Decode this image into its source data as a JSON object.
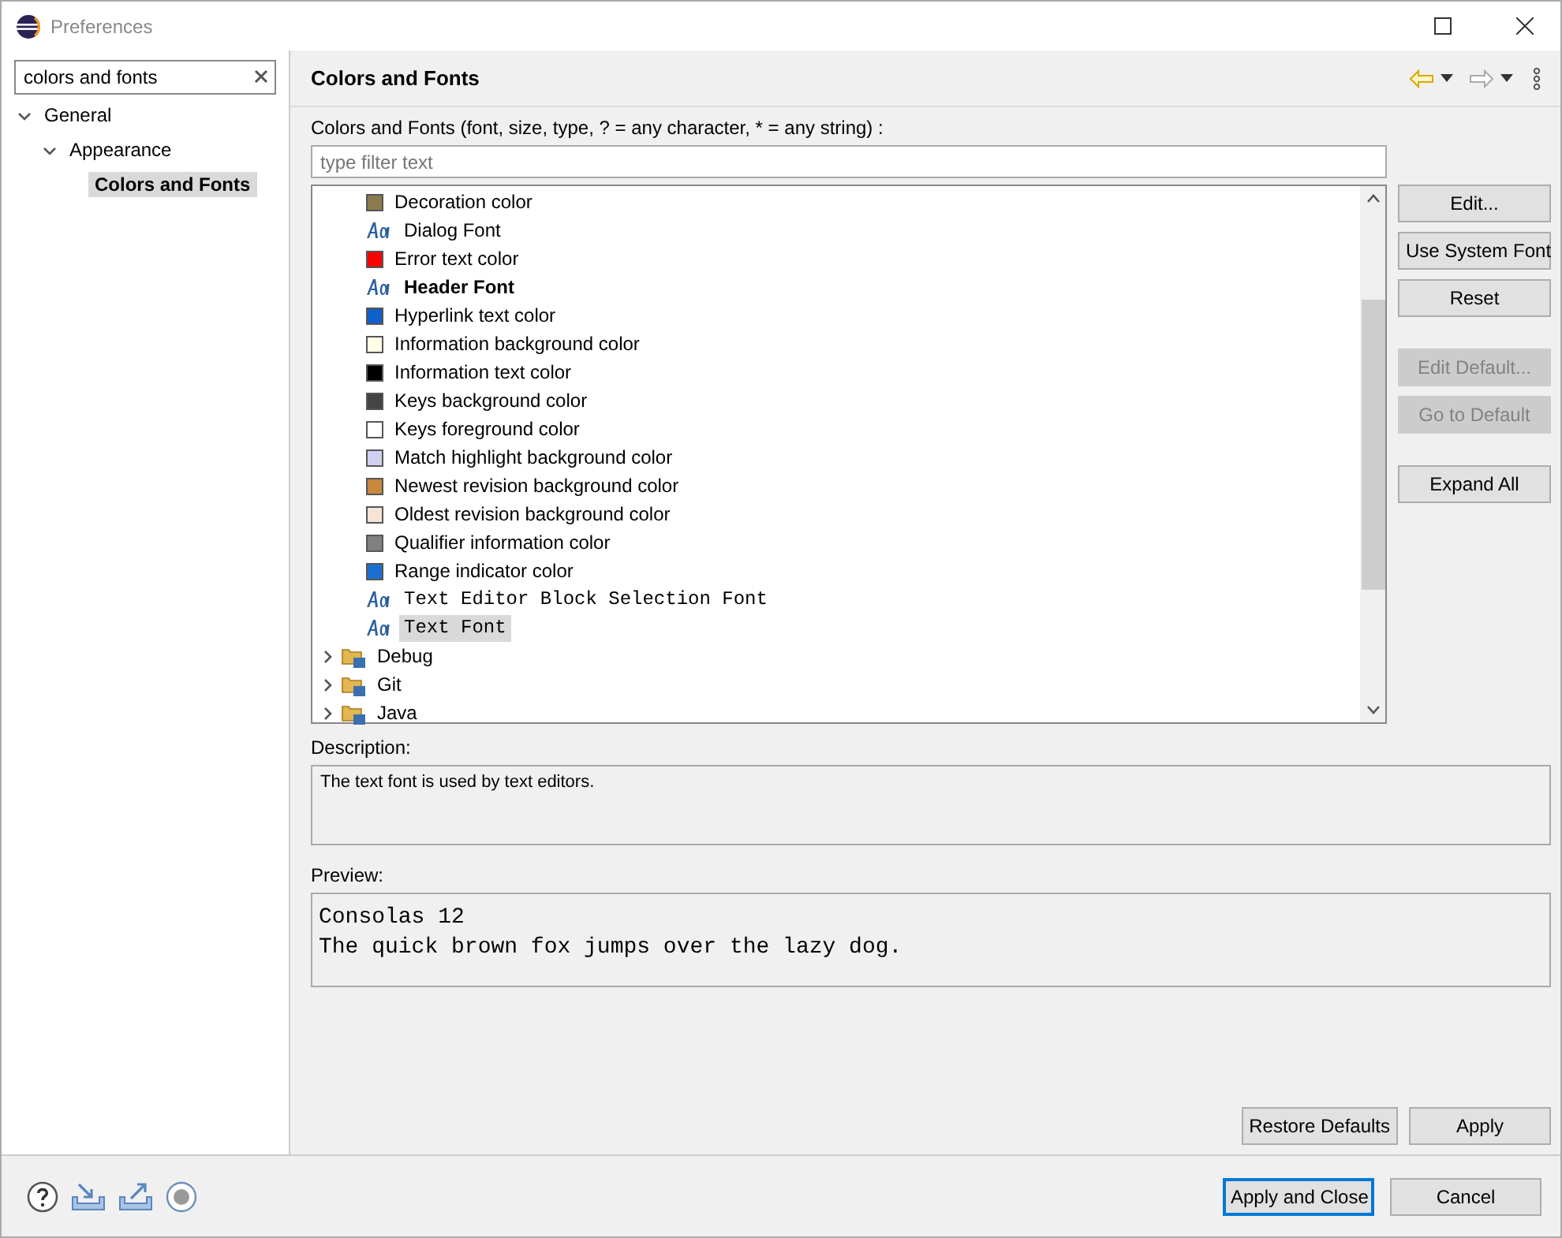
{
  "window": {
    "title": "Preferences"
  },
  "search": {
    "value": "colors and fonts"
  },
  "nav_tree": [
    {
      "label": "General",
      "expanded": true,
      "selected": false,
      "children": [
        {
          "label": "Appearance",
          "expanded": true,
          "selected": false,
          "children": [
            {
              "label": "Colors and Fonts",
              "selected": true
            }
          ]
        }
      ]
    }
  ],
  "page": {
    "title": "Colors and Fonts",
    "filter_label": "Colors and Fonts (font, size, type, ? = any character, * = any string) :",
    "filter": {
      "placeholder": "type filter text"
    }
  },
  "items": [
    {
      "kind": "color",
      "label": "Decoration color",
      "color": "#8b7a4e",
      "selected": false
    },
    {
      "kind": "font",
      "label": "Dialog Font",
      "selected": false
    },
    {
      "kind": "color",
      "label": "Error text color",
      "color": "#ff0000",
      "selected": false
    },
    {
      "kind": "boldfont",
      "label": "Header Font",
      "selected": false
    },
    {
      "kind": "color",
      "label": "Hyperlink text color",
      "color": "#0f5fcc",
      "selected": false
    },
    {
      "kind": "color",
      "label": "Information background color",
      "color": "#ffffe6",
      "selected": false
    },
    {
      "kind": "color",
      "label": "Information text color",
      "color": "#000000",
      "selected": false
    },
    {
      "kind": "color",
      "label": "Keys background color",
      "color": "#444444",
      "selected": false
    },
    {
      "kind": "color",
      "label": "Keys foreground color",
      "color": "#ffffff",
      "selected": false
    },
    {
      "kind": "color",
      "label": "Match highlight background color",
      "color": "#d0d0f0",
      "selected": false
    },
    {
      "kind": "color",
      "label": "Newest revision background color",
      "color": "#c8883e",
      "selected": false
    },
    {
      "kind": "color",
      "label": "Oldest revision background color",
      "color": "#f5e3d6",
      "selected": false
    },
    {
      "kind": "color",
      "label": "Qualifier information color",
      "color": "#808080",
      "selected": false
    },
    {
      "kind": "color",
      "label": "Range indicator color",
      "color": "#1a6fd0",
      "selected": false
    },
    {
      "kind": "monofont",
      "label": "Text Editor Block Selection Font",
      "selected": false
    },
    {
      "kind": "monofont",
      "label": "Text Font",
      "selected": true
    },
    {
      "kind": "category",
      "label": "Debug",
      "expanded": false
    },
    {
      "kind": "category",
      "label": "Git",
      "expanded": false
    },
    {
      "kind": "category",
      "label": "Java",
      "expanded": false
    }
  ],
  "side_buttons": [
    {
      "label": "Edit...",
      "disabled": false
    },
    {
      "label": "Use System Font",
      "disabled": false
    },
    {
      "label": "Reset",
      "disabled": false
    },
    {
      "label": "Edit Default...",
      "disabled": true
    },
    {
      "label": "Go to Default",
      "disabled": true
    },
    {
      "label": "Expand All",
      "disabled": false
    }
  ],
  "description": {
    "label": "Description:",
    "text": "The text font is used by text editors."
  },
  "preview": {
    "label": "Preview:",
    "lines": [
      "Consolas 12",
      "The quick brown fox jumps over the lazy dog."
    ]
  },
  "page_buttons": [
    "Restore Defaults",
    "Apply"
  ],
  "dialog_buttons": [
    {
      "label": "Apply and Close",
      "default": true
    },
    {
      "label": "Cancel",
      "default": false
    }
  ]
}
